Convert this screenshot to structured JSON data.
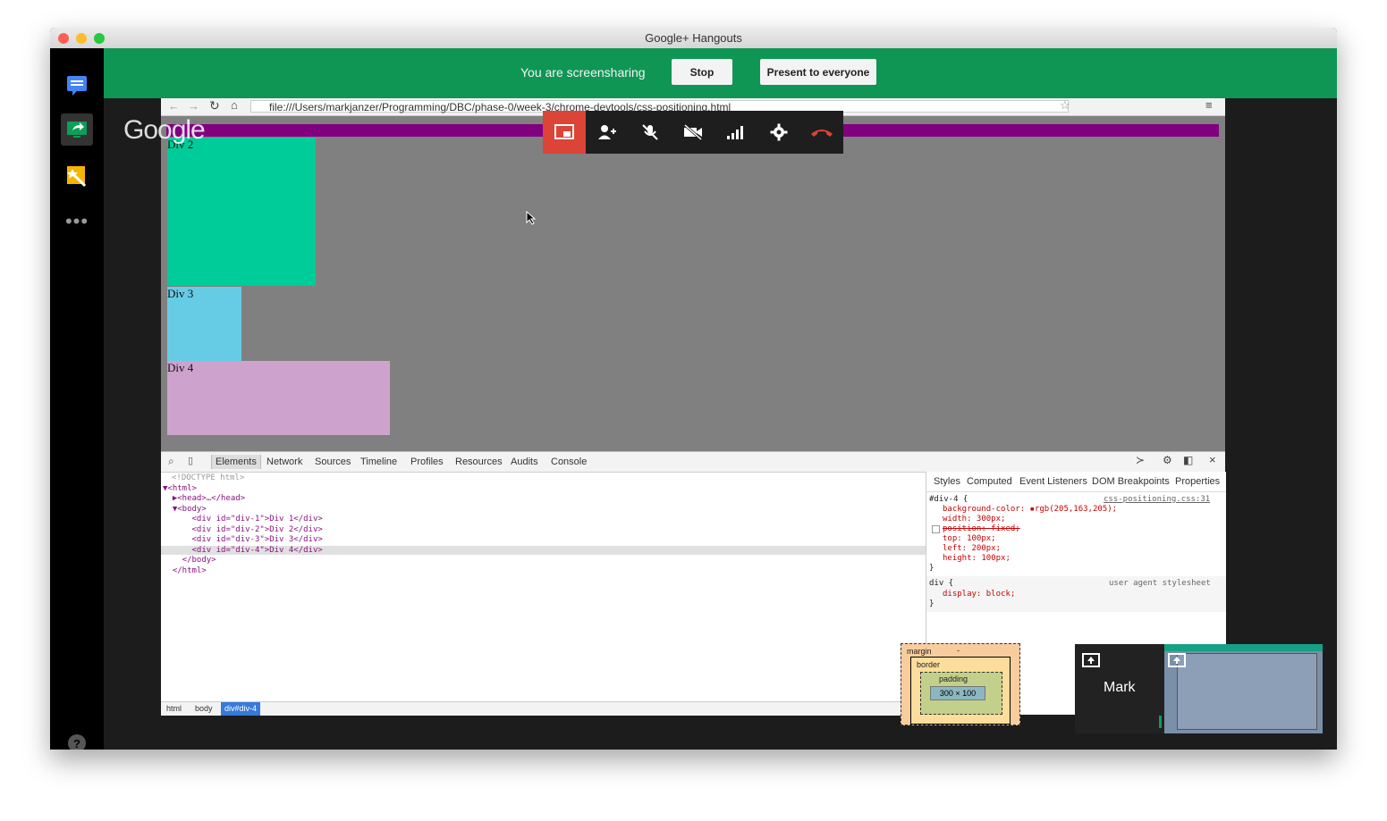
{
  "window": {
    "title": "Google+ Hangouts"
  },
  "sharebar": {
    "status": "You are screensharing",
    "stop_label": "Stop",
    "present_label": "Present to everyone",
    "color": "#0f9d58"
  },
  "sidebar": {
    "icons": [
      "chat-icon",
      "screenshare-icon",
      "effects-icon",
      "more-icon"
    ],
    "help": "?"
  },
  "google_logo": "Google",
  "browser": {
    "url": "file:///Users/markjanzer/Programming/DBC/phase-0/week-3/chrome-devtools/css-positioning.html",
    "divs": {
      "div2": "Div 2",
      "div3": "Div 3",
      "div4": "Div 4"
    },
    "colors": {
      "div2": "#00cc99",
      "div3": "#66cce6",
      "div4": "#cda3cd",
      "bar": "#800080"
    }
  },
  "callbar": {
    "icons": [
      "screen-icon",
      "add-person-icon",
      "mic-off-icon",
      "video-off-icon",
      "signal-icon",
      "settings-icon",
      "hangup-icon"
    ]
  },
  "devtools": {
    "tabs": [
      "Elements",
      "Network",
      "Sources",
      "Timeline",
      "Profiles",
      "Resources",
      "Audits",
      "Console"
    ],
    "elements": [
      "<!DOCTYPE html>",
      "▼<html>",
      "  ▶<head>…</head>",
      "  ▼<body>",
      "      <div id=\"div-1\">Div 1</div>",
      "      <div id=\"div-2\">Div 2</div>",
      "      <div id=\"div-3\">Div 3</div>",
      "      <div id=\"div-4\">Div 4</div>",
      "    </body>",
      "  </html>"
    ],
    "breadcrumb": [
      "html",
      "body",
      "div#div-4"
    ],
    "styles": {
      "tabs": [
        "Styles",
        "Computed",
        "Event Listeners",
        "DOM Breakpoints",
        "Properties"
      ],
      "selector": "#div-4 {",
      "source": "css-positioning.css:31",
      "rules": [
        "background-color: ▪rgb(205,163,205);",
        "width: 300px;",
        "position: fixed;",
        "top: 100px;",
        "left: 200px;",
        "height: 100px;"
      ],
      "close": "}",
      "ua_selector": "div {",
      "ua_source": "user agent stylesheet",
      "ua_rule": "display: block;",
      "ua_close": "}",
      "boxmodel": {
        "margin": "margin",
        "border": "border",
        "padding": "padding",
        "content": "300 × 100",
        "dash": "-"
      }
    }
  },
  "participant": {
    "name": "Mark"
  }
}
